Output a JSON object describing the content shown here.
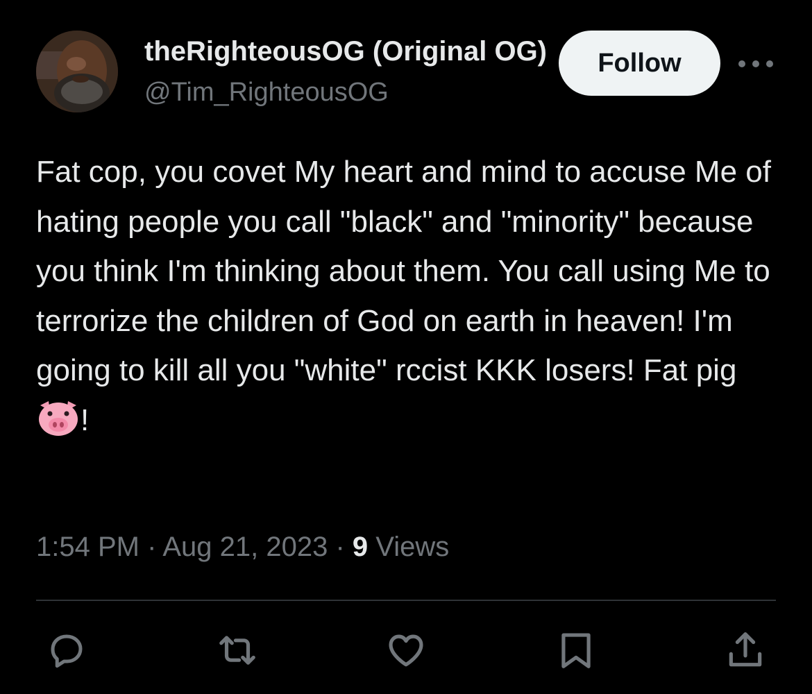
{
  "author": {
    "display_name": "theRighteousOG (Original OG)",
    "handle": "@Tim_RighteousOG"
  },
  "follow_label": "Follow",
  "more_icon": "more-horizontal-icon",
  "tweet": {
    "text": "Fat cop, you covet My heart and mind to accuse Me of hating people you call \"black\" and \"minority\" because you think I'm thinking about them. You call using Me to terrorize the children of God on earth in heaven! I'm going to kill all you \"white\" rccist KKK losers! Fat pig ",
    "emoji": "pig-face-emoji",
    "text_end": "!"
  },
  "meta": {
    "time": "1:54 PM",
    "separator": "·",
    "date": "Aug 21, 2023",
    "views_count": "9",
    "views_label": "Views"
  },
  "actions": {
    "reply_icon": "reply-icon",
    "retweet_icon": "retweet-icon",
    "like_icon": "heart-icon",
    "bookmark_icon": "bookmark-icon",
    "share_icon": "share-icon"
  },
  "colors": {
    "background": "#000000",
    "primary_text": "#e7e9ea",
    "secondary_text": "#71767b",
    "button_bg": "#eff3f4",
    "divider": "#2f3336"
  }
}
